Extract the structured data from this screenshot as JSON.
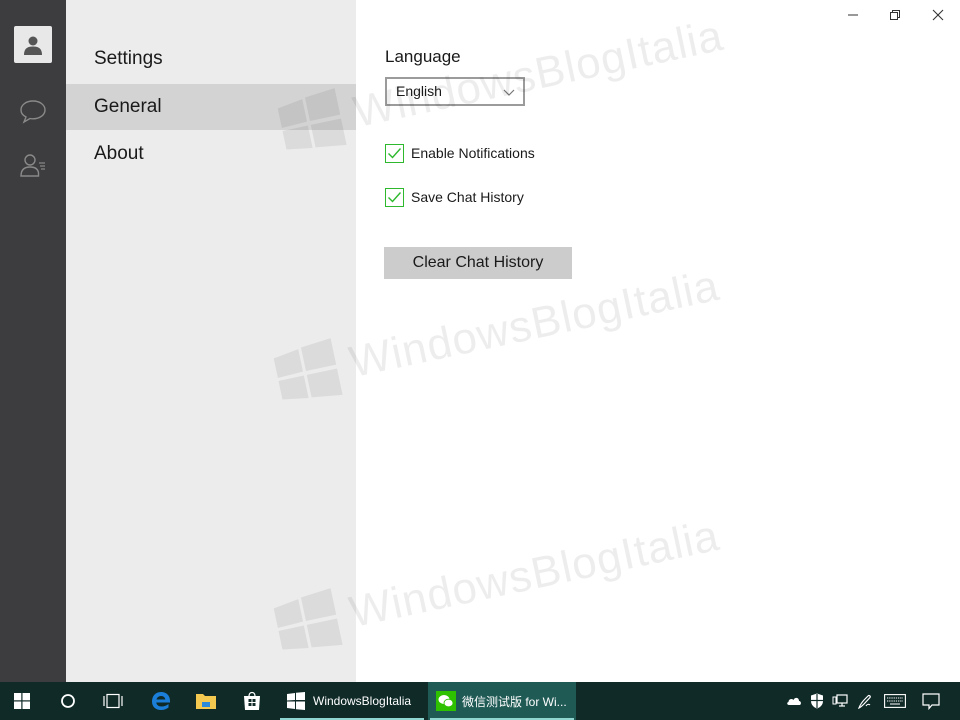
{
  "window": {
    "controls": {
      "minimize": "minimize",
      "restore": "restore",
      "close": "close"
    }
  },
  "rail": {
    "items": [
      {
        "icon": "avatar-icon"
      },
      {
        "icon": "chat-icon"
      },
      {
        "icon": "contacts-icon"
      }
    ]
  },
  "nav": {
    "title": "Settings",
    "items": [
      {
        "label": "General",
        "active": true
      },
      {
        "label": "About",
        "active": false
      }
    ]
  },
  "general": {
    "language_label": "Language",
    "language_value": "English",
    "checkboxes": [
      {
        "label": "Enable Notifications",
        "checked": true
      },
      {
        "label": "Save Chat History",
        "checked": true
      }
    ],
    "clear_button": "Clear Chat History"
  },
  "watermark": {
    "text": "WindowsBlogItalia"
  },
  "colors": {
    "rail_bg": "#3d3d3f",
    "nav_bg": "#ececec",
    "nav_active": "#d3d3d3",
    "check_green": "#2db82d",
    "taskbar_bg": "#0f2a27",
    "taskbar_active": "#1f5a55",
    "wechat_green": "#2dc100"
  },
  "taskbar": {
    "pinned": [
      {
        "icon": "start-icon"
      },
      {
        "icon": "cortana-icon"
      },
      {
        "icon": "task-view-icon"
      },
      {
        "icon": "edge-icon"
      },
      {
        "icon": "file-explorer-icon"
      },
      {
        "icon": "store-icon"
      }
    ],
    "apps": [
      {
        "label": "WindowsBlogItalia",
        "icon": "windowsblogitalia-icon",
        "active": false
      },
      {
        "label": "微信测试版 for Wi...",
        "icon": "wechat-icon",
        "active": true
      }
    ],
    "tray": [
      {
        "icon": "onedrive-icon"
      },
      {
        "icon": "defender-icon"
      },
      {
        "icon": "network-icon"
      },
      {
        "icon": "pen-icon"
      },
      {
        "icon": "keyboard-icon"
      },
      {
        "icon": "action-center-icon"
      }
    ]
  }
}
